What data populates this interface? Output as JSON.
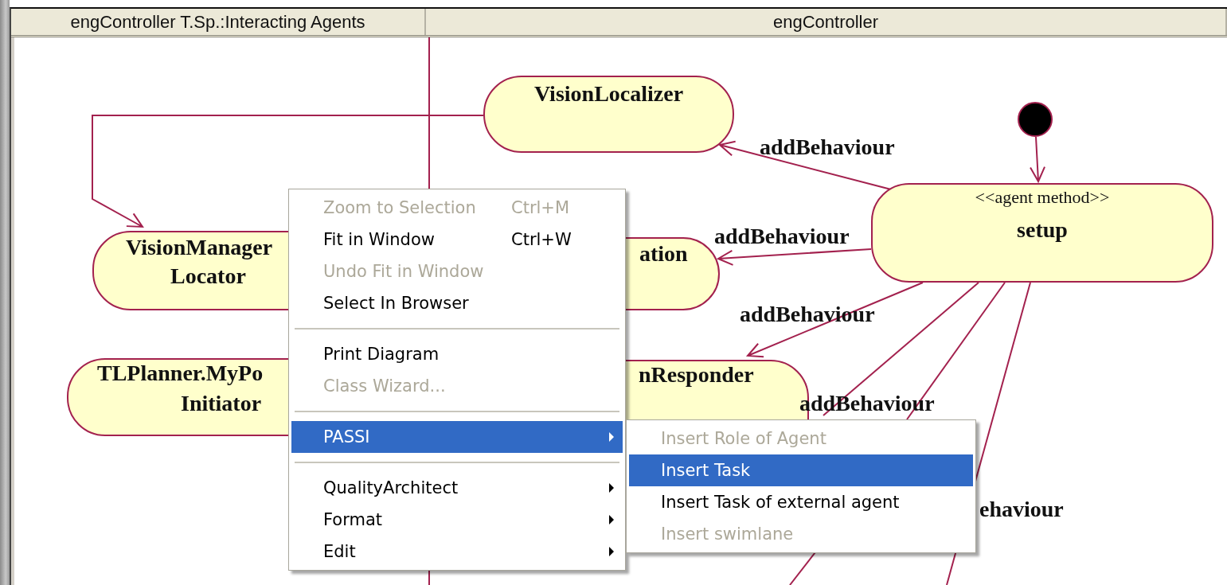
{
  "header": {
    "columns": [
      {
        "label": "engController T.Sp.:Interacting Agents"
      },
      {
        "label": "engController"
      }
    ]
  },
  "diagram": {
    "nodes": [
      {
        "kind": "initial"
      },
      {
        "kind": "activity",
        "lines": [
          "VisionLocalizer"
        ]
      },
      {
        "kind": "activity",
        "stereotype": "<<agent method>>",
        "lines": [
          "setup"
        ]
      },
      {
        "kind": "activity",
        "lines": [
          "VisionManager",
          "Locator"
        ]
      },
      {
        "kind": "activity",
        "lines": [
          "ation"
        ]
      },
      {
        "kind": "activity",
        "lines": [
          "TLPlanner.MyPo",
          "Initiator"
        ]
      },
      {
        "kind": "activity",
        "lines": [
          "nResponder"
        ]
      }
    ],
    "edges": [
      {
        "arrow": true
      },
      {
        "arrow": true
      },
      {
        "arrow": true
      },
      {
        "arrow": true
      },
      {
        "arrow": true
      },
      {
        "arrow": false
      },
      {
        "arrow": false
      },
      {
        "arrow": false
      },
      {
        "arrow": false
      }
    ],
    "edge_labels": [
      "addBehaviour",
      "addBehaviour",
      "addBehaviour",
      "addBehaviour",
      "ehaviour"
    ]
  },
  "context_menu": {
    "items": [
      {
        "kind": "item",
        "label": "Zoom to Selection",
        "shortcut": "Ctrl+M",
        "disabled": true,
        "selected": false,
        "submenu": false
      },
      {
        "kind": "item",
        "label": "Fit in Window",
        "shortcut": "Ctrl+W",
        "disabled": false,
        "selected": false,
        "submenu": false
      },
      {
        "kind": "item",
        "label": "Undo Fit in Window",
        "disabled": true,
        "selected": false,
        "submenu": false
      },
      {
        "kind": "item",
        "label": "Select In Browser",
        "disabled": false,
        "selected": false,
        "submenu": false
      },
      {
        "kind": "separator"
      },
      {
        "kind": "item",
        "label": "Print Diagram",
        "disabled": false,
        "selected": false,
        "submenu": false
      },
      {
        "kind": "item",
        "label": "Class Wizard...",
        "disabled": true,
        "selected": false,
        "submenu": false
      },
      {
        "kind": "separator"
      },
      {
        "kind": "item",
        "label": "PASSI",
        "disabled": false,
        "selected": true,
        "submenu": true
      },
      {
        "kind": "separator"
      },
      {
        "kind": "item",
        "label": "QualityArchitect",
        "disabled": false,
        "selected": false,
        "submenu": true
      },
      {
        "kind": "item",
        "label": "Format",
        "disabled": false,
        "selected": false,
        "submenu": true
      },
      {
        "kind": "item",
        "label": "Edit",
        "disabled": false,
        "selected": false,
        "submenu": true
      }
    ]
  },
  "submenu": {
    "items": [
      {
        "kind": "item",
        "label": "Insert Role of Agent",
        "disabled": true,
        "selected": false,
        "submenu": false
      },
      {
        "kind": "item",
        "label": "Insert Task",
        "disabled": false,
        "selected": true,
        "submenu": false
      },
      {
        "kind": "item",
        "label": "Insert Task of external agent",
        "disabled": false,
        "selected": false,
        "submenu": false
      },
      {
        "kind": "item",
        "label": "Insert swimlane",
        "disabled": true,
        "selected": false,
        "submenu": false
      }
    ]
  }
}
